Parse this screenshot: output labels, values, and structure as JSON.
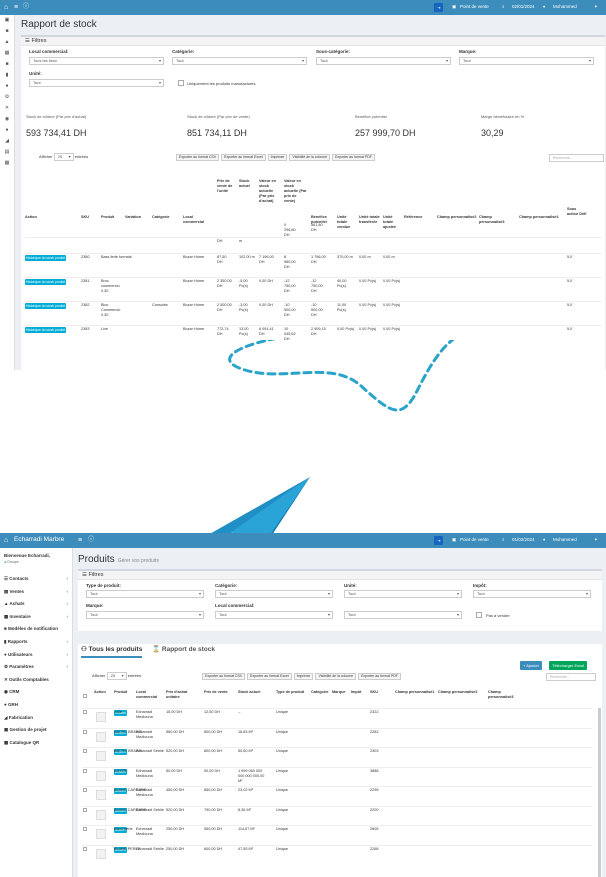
{
  "s1": {
    "topbar": {
      "btn_blue": "⇥",
      "pos": "Point de vente",
      "date": "02/01/2024",
      "user": "Mohammed"
    },
    "page_title": "Rapport de stock",
    "filters_title": "Filtres",
    "f_local_label": "Local commercial:",
    "f_local_value": "Tous les lieux",
    "f_cat_label": "Catégorie:",
    "f_cat_value": "Tout",
    "f_subcat_label": "Sous-catégorie:",
    "f_subcat_value": "Tout",
    "f_brand_label": "Marque:",
    "f_brand_value": "Tout",
    "f_unit_label": "Unité:",
    "f_unit_value": "Tout",
    "f_only_label": "Uniquement les produits manufacturés",
    "stats": [
      {
        "label": "Stock de clôture (Par prix d'achat)",
        "value": "593 734,41 DH"
      },
      {
        "label": "Stock de clôture (Par prix de vente)",
        "value": "851 734,11 DH"
      },
      {
        "label": "Bénéfice potentiel",
        "value": "257 999,70 DH"
      },
      {
        "label": "Marge bénéficiaire en %",
        "value": "30,29"
      }
    ],
    "show": "Afficher",
    "len": "25",
    "entries": "entrées",
    "exports": [
      "Exporter au format CSV",
      "Exporter au format Excel",
      "Imprimer",
      "Visibilité de la colonne",
      "Exporter au format PDF"
    ],
    "search": "Recherche ...",
    "headers": [
      "Action",
      "SKU",
      "Produit",
      "Variation",
      "Catégorie",
      "Local commercial",
      "Prix de vente de l'unité",
      "Stock actuel",
      "Valeur en stock actuelle (Par prix d'achat)",
      "Valeur en stock actuelle (Par prix de vente)",
      "Bénéfice potentiel",
      "Unité totale vendue",
      "Unité totale transférée",
      "Unité totale ajustée",
      "Référence",
      "Champ personnalisé2",
      "Champ personnalisé3",
      "Champ personnalisé4",
      "Sous action Défi"
    ],
    "totals": {
      "prix": "DH",
      "stock": "m",
      "vpa": "",
      "vpv": "0\n296,80\nDH",
      "ben": "561,80\nDH"
    },
    "action_btn": "Historique du stock produit",
    "rows": [
      {
        "sku": "2380",
        "prod": "Bass fede formats",
        "var": "",
        "cat": "",
        "loc": "Bozar Home",
        "prix": "87,50\nDH",
        "stock": "102,00 m",
        "vpa": "7 196,00\nDH",
        "vpv": "8\n960,00\nDH",
        "ben": "1 796,00\nDH",
        "vend": "370,00 m",
        "trans": "0,00 m",
        "adj": "0,00 m",
        "last": "5,0"
      },
      {
        "sku": "2381",
        "prod": "Broc\ncommercio\n0.30",
        "var": "",
        "cat": "",
        "loc": "Bozar Home",
        "prix": "2 350,00\nDH",
        "stock": "-5,00\nPc(s)",
        "vpa": "0,00 DH",
        "vpv": "-12\n750,00\nDH",
        "ben": "-12\n750,00\nDH",
        "vend": "40,00\nPc(s)",
        "trans": "0,00 Pc(s)",
        "adj": "0,00 Pc(s)",
        "last": "5,0"
      },
      {
        "sku": "2382",
        "prod": "Bloc\nCommercio\n0.30",
        "var": "",
        "cat": "Consoles",
        "loc": "Bozar Home",
        "prix": "2 500,00\nDH",
        "stock": "-3,00\nPc(s)",
        "vpa": "0,00 DH",
        "vpv": "-10\n500,00\nDH",
        "ben": "-10\n500,00\nDH",
        "vend": "11,00\nPc(s)",
        "trans": "0,00 Pc(s)",
        "adj": "0,00 Pc(s)",
        "last": "5,0"
      },
      {
        "sku": "2383",
        "prod": "Livé",
        "var": "",
        "cat": "",
        "loc": "Bozar Home",
        "prix": "772,74\nDH",
        "stock": "13,00\nPc(s)",
        "vpa": "6 091,41\nDH",
        "vpv": "10\n045,62\nDH",
        "ben": "2 909,15\nDH",
        "vend": "0,00 Pc(s)",
        "trans": "0,00 Pc(s)",
        "adj": "0,00 Pc(s)",
        "last": "5,0"
      }
    ]
  },
  "s2": {
    "topbar": {
      "brand": "Echarradi Marbre",
      "btn_blue": "⇥",
      "pos": "Point de vente",
      "date": "01/02/2024",
      "user": "Mohammed"
    },
    "welcome": "Bienvenue Echarradi,",
    "status": "Groupe",
    "menu": [
      {
        "label": "Contacts",
        "arrow": "‹"
      },
      {
        "label": "Ventes",
        "arrow": "‹"
      },
      {
        "label": "Achats",
        "arrow": "‹"
      },
      {
        "label": "Inventaire",
        "arrow": "‹"
      },
      {
        "label": "Modèles de notification",
        "arrow": ""
      },
      {
        "label": "Rapports",
        "arrow": "‹"
      },
      {
        "label": "Utilisateurs",
        "arrow": "‹"
      },
      {
        "label": "Paramètres",
        "arrow": "‹"
      },
      {
        "label": "Outils Comptables",
        "arrow": ""
      },
      {
        "label": "CRM",
        "arrow": ""
      },
      {
        "label": "GRH",
        "arrow": ""
      },
      {
        "label": "Fabrication",
        "arrow": ""
      },
      {
        "label": "Gestion de projet",
        "arrow": ""
      },
      {
        "label": "Catalogue QR",
        "arrow": ""
      }
    ],
    "page_title": "Produits",
    "page_sub": "Gérer vos produits",
    "filters_title": "Filtres",
    "f_type_label": "Type de produit:",
    "f_type_value": "Tout",
    "f_cat_label": "Catégorie:",
    "f_cat_value": "Tout",
    "f_unit_label": "Unité:",
    "f_unit_value": "Tout",
    "f_tax_label": "Impôt:",
    "f_tax_value": "Tout",
    "f_brand_label": "Marque:",
    "f_brand_value": "Tout",
    "f_local_label": "Local commercial:",
    "f_local_value": "Tout",
    "f_extra_value": "Tout",
    "f_notsale_label": "Pas à vendre",
    "tab_all": "Tous les produits",
    "tab_stock": "Rapport de stock",
    "btn_add": "+ Ajouter",
    "btn_dl": "Télécharger Excel",
    "show": "Afficher",
    "len": "25",
    "entries": "entrées",
    "exports": [
      "Exporter au format CSV",
      "Exporter au format Excel",
      "Imprimer",
      "Visibilité de la colonne",
      "Exporter au format PDF"
    ],
    "search": "Recherche ...",
    "headers": [
      "Action",
      "Produit",
      "Local commercial",
      "Prix d'achat unitaire",
      "Prix de vente",
      "Stock actuel",
      "Type de produit",
      "Catégorie",
      "Marque",
      "Impôt",
      "SKU",
      "Champ personnalisé1",
      "Champ personnalisé2",
      "Champ personnalisé3"
    ],
    "action_btn": "Actions",
    "rows": [
      {
        "prod": "Jolie",
        "loc": "Echarradi\nMediouna",
        "achat": "15,00 DH",
        "vente": "12,50 DH",
        "stock": "--",
        "type": "Unique",
        "sku": "2322"
      },
      {
        "prod": "BALTIC BRAWN",
        "loc": "Echarradi\nMediouna",
        "achat": "560,00 DH",
        "vente": "800,00 DH",
        "stock": "16,83 M²",
        "type": "Unique",
        "sku": "2283"
      },
      {
        "prod": "BALTIC BRAWN",
        "loc": "Echarradi Sebile",
        "achat": "520,00 DH",
        "vente": "800,00 DH",
        "stock": "50,60 M²",
        "type": "Unique",
        "sku": "2303"
      },
      {
        "prod": "BIZOTE",
        "loc": "Echarradi\nMediouna",
        "achat": "50,00 DH",
        "vente": "90,00 DH",
        "stock": "1 999 060 000\n000 000 000,00\nM²",
        "type": "Unique",
        "sku": "3888"
      },
      {
        "prod": "BLANC CARRARE",
        "loc": "Echarradi\nMediouna",
        "achat": "450,00 DH",
        "vente": "850,00 DH",
        "stock": "23,02 M²",
        "type": "Unique",
        "sku": "2295"
      },
      {
        "prod": "BLANC CARRARE",
        "loc": "Echarradi Sebile",
        "achat": "520,00 DH",
        "vente": "790,00 DH",
        "stock": "8,36 M²",
        "type": "Unique",
        "sku": "2200"
      },
      {
        "prod": "blanc perle",
        "loc": "Echarradi\nMediouna",
        "achat": "250,00 DH",
        "vente": "550,00 DH",
        "stock": "114,67 M²",
        "type": "Unique",
        "sku": "2605"
      },
      {
        "prod": "BLANC PERLE",
        "loc": "Echarradi Sebile",
        "achat": "250,00 DH",
        "vente": "600,00 DH",
        "stock": "47,55 M²",
        "type": "Unique",
        "sku": "2268"
      }
    ]
  }
}
